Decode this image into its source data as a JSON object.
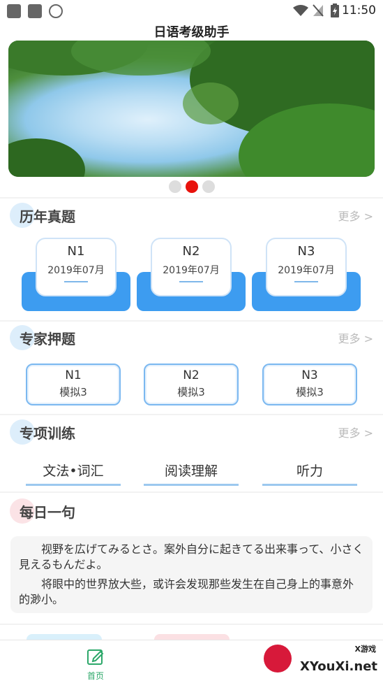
{
  "status_bar": {
    "time": "11:50"
  },
  "app": {
    "title": "日语考级助手"
  },
  "carousel": {
    "pages": 3,
    "active_index": 1
  },
  "past_exams": {
    "title": "历年真题",
    "more": "更多 >",
    "items": [
      {
        "level": "N1",
        "date": "2019年07月"
      },
      {
        "level": "N2",
        "date": "2019年07月"
      },
      {
        "level": "N3",
        "date": "2019年07月"
      }
    ]
  },
  "expert_predictions": {
    "title": "专家押题",
    "more": "更多 >",
    "items": [
      {
        "level": "N1",
        "label": "模拟3"
      },
      {
        "level": "N2",
        "label": "模拟3"
      },
      {
        "level": "N3",
        "label": "模拟3"
      }
    ]
  },
  "special_training": {
    "title": "专项训练",
    "more": "更多 >",
    "items": [
      "文法•词汇",
      "阅读理解",
      "听力"
    ]
  },
  "daily_sentence": {
    "title": "每日一句",
    "japanese": "视野を広げてみるとさ。案外自分に起きてる出来事って、小さく見えるもんだよ。",
    "chinese": "将眼中的世界放大些，或许会发现那些发生在自己身上的事意外的渺小。"
  },
  "tab_bar": {
    "home_label": "首页"
  },
  "watermark": {
    "text": "XYouXi.net",
    "small": "X游戏"
  },
  "colors": {
    "accent_blue": "#3d9cf0",
    "active_dot": "#e8120c",
    "tab_active": "#2da86a"
  }
}
